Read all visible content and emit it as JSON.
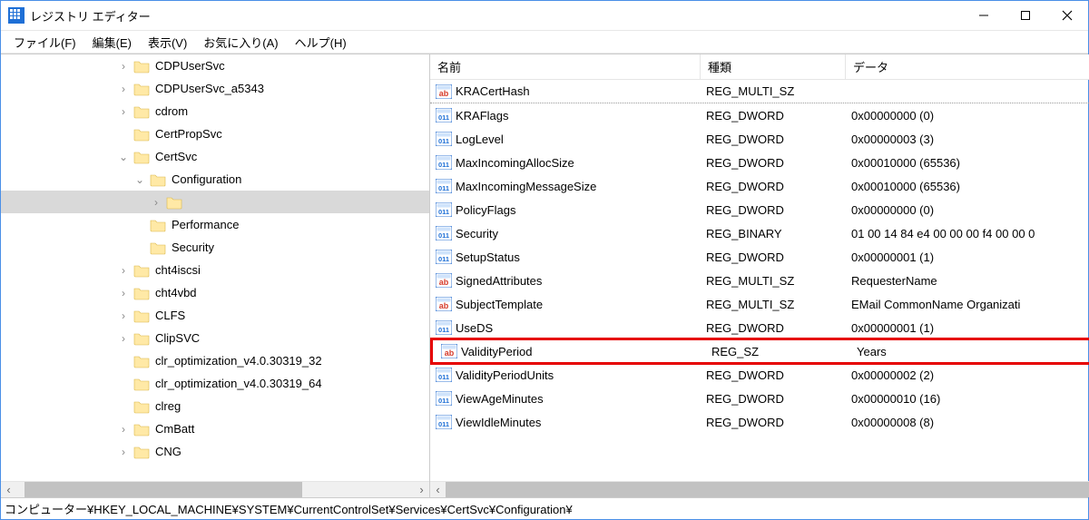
{
  "window": {
    "title": "レジストリ エディター"
  },
  "menu": {
    "file": "ファイル(F)",
    "edit": "編集(E)",
    "view": "表示(V)",
    "favorites": "お気に入り(A)",
    "help": "ヘルプ(H)"
  },
  "tree": {
    "items": [
      {
        "indent": 3,
        "expander": ">",
        "label": "CDPUserSvc"
      },
      {
        "indent": 3,
        "expander": ">",
        "label": "CDPUserSvc_a5343"
      },
      {
        "indent": 3,
        "expander": ">",
        "label": "cdrom"
      },
      {
        "indent": 3,
        "expander": "",
        "label": "CertPropSvc"
      },
      {
        "indent": 3,
        "expander": "v",
        "label": "CertSvc"
      },
      {
        "indent": 4,
        "expander": "v",
        "label": "Configuration"
      },
      {
        "indent": 5,
        "expander": ">",
        "label": "",
        "selected": true
      },
      {
        "indent": 4,
        "expander": "",
        "label": "Performance"
      },
      {
        "indent": 4,
        "expander": "",
        "label": "Security"
      },
      {
        "indent": 3,
        "expander": ">",
        "label": "cht4iscsi"
      },
      {
        "indent": 3,
        "expander": ">",
        "label": "cht4vbd"
      },
      {
        "indent": 3,
        "expander": ">",
        "label": "CLFS"
      },
      {
        "indent": 3,
        "expander": ">",
        "label": "ClipSVC"
      },
      {
        "indent": 3,
        "expander": "",
        "label": "clr_optimization_v4.0.30319_32"
      },
      {
        "indent": 3,
        "expander": "",
        "label": "clr_optimization_v4.0.30319_64"
      },
      {
        "indent": 3,
        "expander": "",
        "label": "clreg"
      },
      {
        "indent": 3,
        "expander": ">",
        "label": "CmBatt"
      },
      {
        "indent": 3,
        "expander": ">",
        "label": "CNG"
      }
    ]
  },
  "columns": {
    "name": "名前",
    "type": "種類",
    "data": "データ"
  },
  "values": [
    {
      "icon": "sz",
      "name": "KRACertHash",
      "type": "REG_MULTI_SZ",
      "data": "",
      "first": true
    },
    {
      "icon": "bin",
      "name": "KRAFlags",
      "type": "REG_DWORD",
      "data": "0x00000000 (0)"
    },
    {
      "icon": "bin",
      "name": "LogLevel",
      "type": "REG_DWORD",
      "data": "0x00000003 (3)"
    },
    {
      "icon": "bin",
      "name": "MaxIncomingAllocSize",
      "type": "REG_DWORD",
      "data": "0x00010000 (65536)"
    },
    {
      "icon": "bin",
      "name": "MaxIncomingMessageSize",
      "type": "REG_DWORD",
      "data": "0x00010000 (65536)"
    },
    {
      "icon": "bin",
      "name": "PolicyFlags",
      "type": "REG_DWORD",
      "data": "0x00000000 (0)"
    },
    {
      "icon": "bin",
      "name": "Security",
      "type": "REG_BINARY",
      "data": "01 00 14 84 e4 00 00 00 f4 00 00 0"
    },
    {
      "icon": "bin",
      "name": "SetupStatus",
      "type": "REG_DWORD",
      "data": "0x00000001 (1)"
    },
    {
      "icon": "sz",
      "name": "SignedAttributes",
      "type": "REG_MULTI_SZ",
      "data": "RequesterName"
    },
    {
      "icon": "sz",
      "name": "SubjectTemplate",
      "type": "REG_MULTI_SZ",
      "data": "EMail CommonName Organizati"
    },
    {
      "icon": "bin",
      "name": "UseDS",
      "type": "REG_DWORD",
      "data": "0x00000001 (1)"
    },
    {
      "icon": "sz",
      "name": "ValidityPeriod",
      "type": "REG_SZ",
      "data": "Years",
      "highlight": true
    },
    {
      "icon": "bin",
      "name": "ValidityPeriodUnits",
      "type": "REG_DWORD",
      "data": "0x00000002 (2)"
    },
    {
      "icon": "bin",
      "name": "ViewAgeMinutes",
      "type": "REG_DWORD",
      "data": "0x00000010 (16)"
    },
    {
      "icon": "bin",
      "name": "ViewIdleMinutes",
      "type": "REG_DWORD",
      "data": "0x00000008 (8)"
    }
  ],
  "statusbar": "コンピューター¥HKEY_LOCAL_MACHINE¥SYSTEM¥CurrentControlSet¥Services¥CertSvc¥Configuration¥"
}
